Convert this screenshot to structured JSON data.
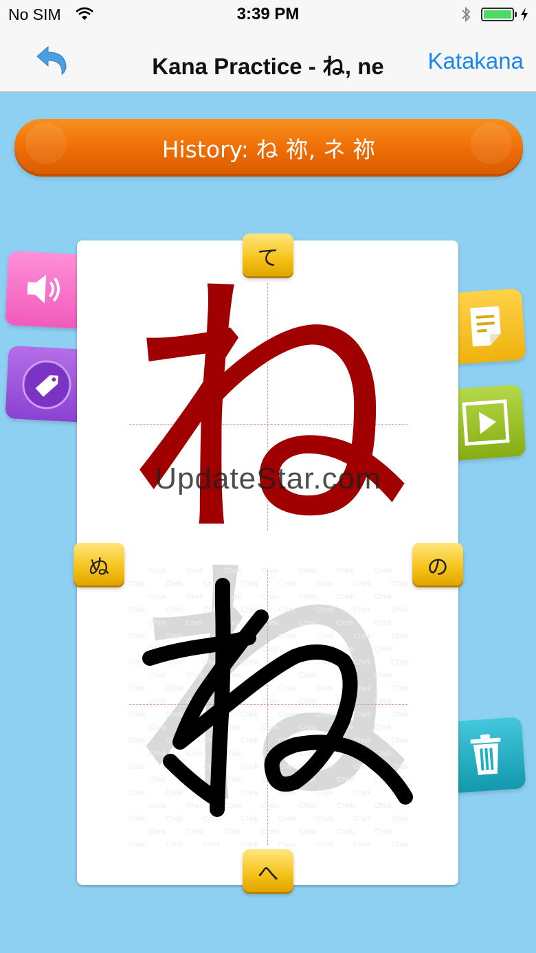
{
  "status_bar": {
    "carrier": "No SIM",
    "time": "3:39 PM",
    "battery_level": 1.0
  },
  "nav_bar": {
    "back_icon": "back-arrow-icon",
    "title": "Kana Practice - ね, ne",
    "right_button": "Katakana"
  },
  "history": {
    "label": "History: ね 祢, ネ 祢"
  },
  "practice": {
    "model_kana": "ね",
    "ghost_kana": "ね",
    "watermark_word": "Chek",
    "overlay_text": "UpdateStar.com"
  },
  "nav_chips": {
    "previous_row": "て",
    "next_row": "へ",
    "previous": "ぬ",
    "next": "の"
  },
  "side_tabs": [
    {
      "name": "sound",
      "icon": "speaker-icon",
      "color": "#f36cc7"
    },
    {
      "name": "tag",
      "icon": "tag-icon",
      "color": "#9b53dc"
    },
    {
      "name": "notes",
      "icon": "note-icon",
      "color": "#f4bd1d"
    },
    {
      "name": "play",
      "icon": "play-icon",
      "color": "#9cc22a"
    },
    {
      "name": "clear",
      "icon": "trash-icon",
      "color": "#22aec3"
    }
  ],
  "colors": {
    "background": "#8ed0f1",
    "history_orange": "#ee6d06",
    "model_red": "#a00000",
    "link_blue": "#1a86f0"
  }
}
